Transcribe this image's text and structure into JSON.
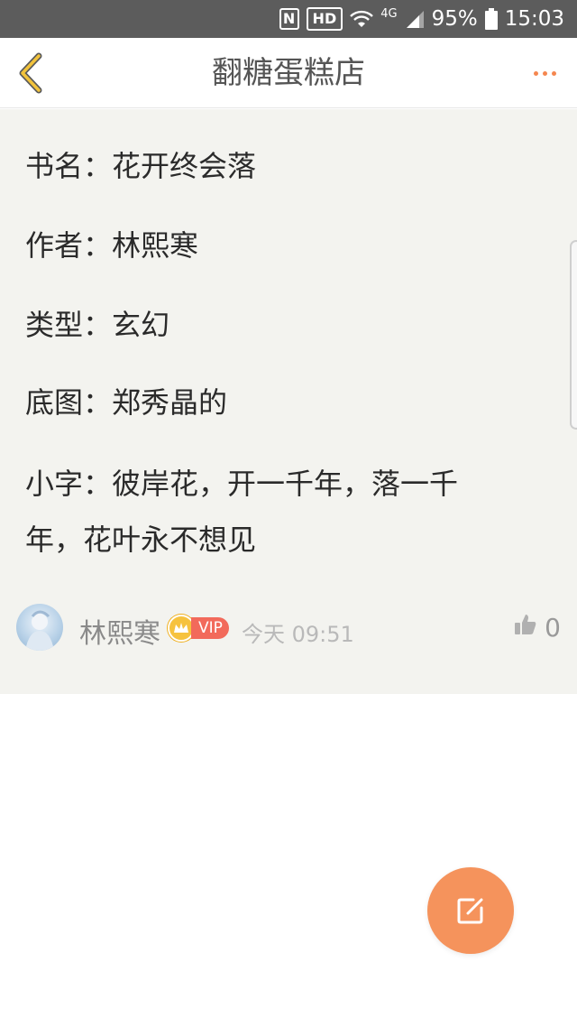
{
  "status_bar": {
    "nfc": "N",
    "hd": "HD",
    "network": "4G",
    "battery": "95%",
    "time": "15:03"
  },
  "header": {
    "title": "翻糖蛋糕店",
    "back_icon": "chevron-left-icon",
    "more_icon": "more-dots-icon",
    "accent": "#f5874f"
  },
  "post": {
    "lines": [
      "书名：花开终会落",
      "作者：林熙寒",
      "类型：玄幻",
      "底图：郑秀晶的",
      "小字：彼岸花，开一千年，落一千",
      "年，花叶永不想见"
    ]
  },
  "author": {
    "name": "林熙寒",
    "vip": "VIP",
    "time": "今天 09:51",
    "likes": "0"
  },
  "fab": {
    "icon": "edit-icon",
    "color": "#f5935c"
  }
}
